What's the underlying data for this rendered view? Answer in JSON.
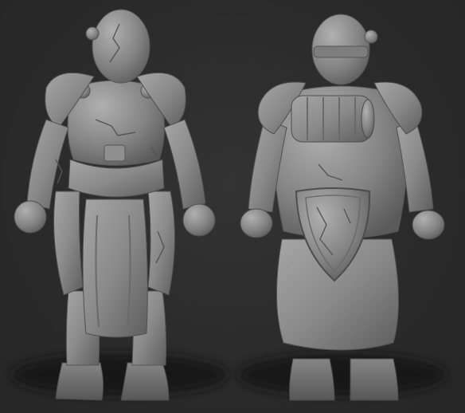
{
  "scene": {
    "background_color": "#2b2b2b",
    "clay_color": "#8a8a8a",
    "shadow_color": "#141414",
    "views": [
      {
        "view": "front"
      },
      {
        "view": "back"
      }
    ]
  }
}
